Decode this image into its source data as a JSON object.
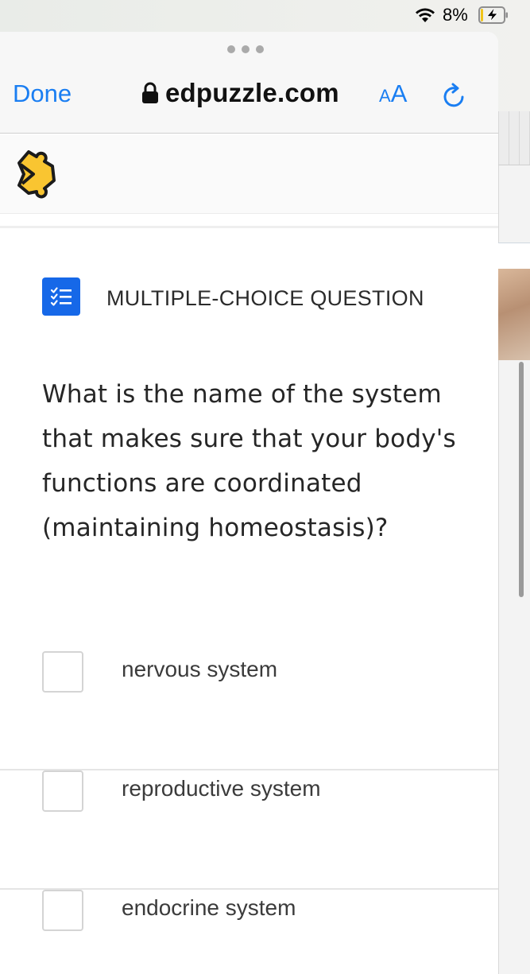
{
  "status_bar": {
    "battery_percent": "8%",
    "icons": [
      "wifi-icon",
      "battery-charging-icon"
    ],
    "battery_level": 0.08
  },
  "browser": {
    "done_label": "Done",
    "url": "edpuzzle.com",
    "text_size_small": "A",
    "text_size_large": "A",
    "icons": [
      "lock-icon",
      "reload-icon",
      "more-dots-icon"
    ],
    "accent_color": "#1a7ef2"
  },
  "site": {
    "logo": "edpuzzle-logo-icon",
    "logo_colors": [
      "#f9c531",
      "#1b1b1b"
    ]
  },
  "question": {
    "type_label": "MULTIPLE-CHOICE QUESTION",
    "type_icon": "checklist-icon",
    "type_icon_color": "#1668e8",
    "text": "What is the name of the system that makes sure that your body's functions are coordinated (maintaining homeostasis)?",
    "choices": [
      {
        "label": "nervous system",
        "checked": false
      },
      {
        "label": "reproductive system",
        "checked": false
      },
      {
        "label": "endocrine system",
        "checked": false
      }
    ]
  }
}
